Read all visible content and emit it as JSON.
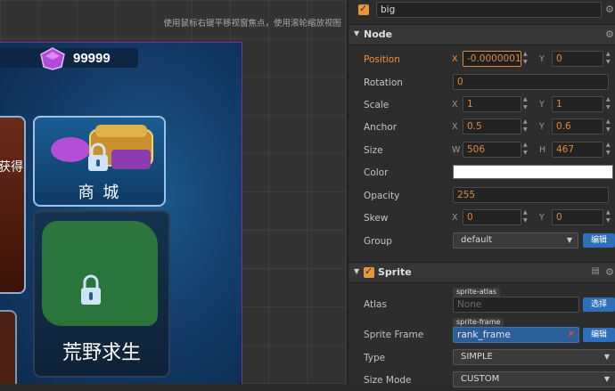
{
  "scene": {
    "hint": "使用鼠标右键平移视窗焦点，使用滚轮缩放视图",
    "coins": "99999",
    "hero_text": "获得",
    "shop_label": "商 城",
    "wild_label": "荒野求生"
  },
  "inspector": {
    "node_name": "big",
    "node_section": "Node",
    "position": {
      "label": "Position",
      "x_axis": "X",
      "x": "-0.0000001",
      "y_axis": "Y",
      "y": "0"
    },
    "rotation": {
      "label": "Rotation",
      "value": "0"
    },
    "scale": {
      "label": "Scale",
      "x_axis": "X",
      "x": "1",
      "y_axis": "Y",
      "y": "1"
    },
    "anchor": {
      "label": "Anchor",
      "x_axis": "X",
      "x": "0.5",
      "y_axis": "Y",
      "y": "0.6"
    },
    "size": {
      "label": "Size",
      "w_axis": "W",
      "w": "506",
      "h_axis": "H",
      "h": "467"
    },
    "color": {
      "label": "Color",
      "value": "#ffffff"
    },
    "opacity": {
      "label": "Opacity",
      "value": "255"
    },
    "skew": {
      "label": "Skew",
      "x_axis": "X",
      "x": "0",
      "y_axis": "Y",
      "y": "0"
    },
    "group": {
      "label": "Group",
      "value": "default",
      "button": "编辑"
    },
    "sprite_section": "Sprite",
    "atlas": {
      "label": "Atlas",
      "tag": "sprite-atlas",
      "placeholder": "None",
      "button": "选择"
    },
    "sprite_frame": {
      "label": "Sprite Frame",
      "tag": "sprite-frame",
      "value": "rank_frame",
      "button": "编辑"
    },
    "type": {
      "label": "Type",
      "value": "SIMPLE"
    },
    "size_mode": {
      "label": "Size Mode",
      "value": "CUSTOM"
    }
  },
  "colors": {
    "accent": "#e6973a",
    "button_blue": "#2d6fb8",
    "panel": "#2d2d2d",
    "section": "#363636"
  }
}
